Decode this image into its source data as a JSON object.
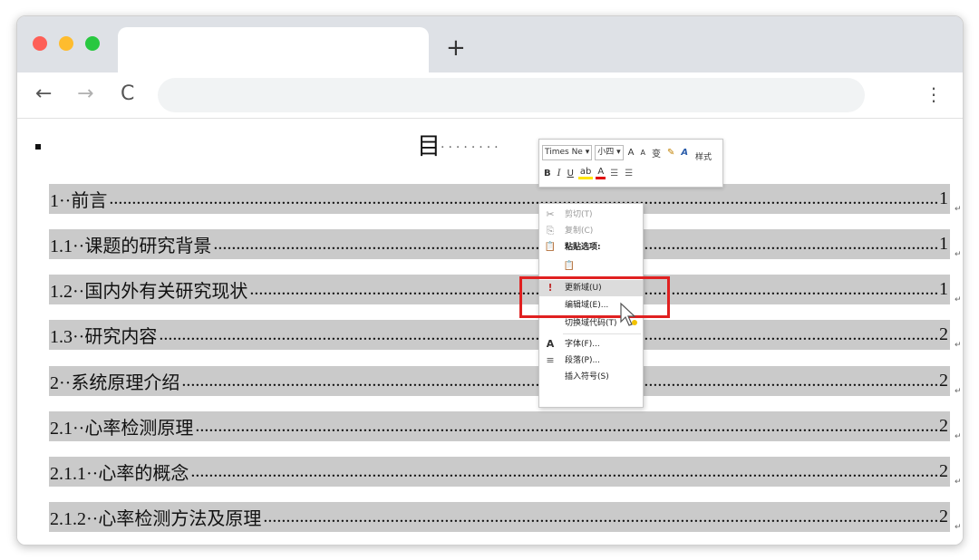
{
  "browser": {
    "new_tab_label": "+",
    "back_icon": "←",
    "forward_icon": "→",
    "reload_icon": "C",
    "menu_icon": "⋮",
    "address_value": ""
  },
  "document": {
    "heading": "目",
    "heading_dots": "········",
    "toc": [
      {
        "title": "1··前言",
        "page": "1"
      },
      {
        "title": "1.1··课题的研究背景",
        "page": "1"
      },
      {
        "title": "1.2··国内外有关研究现状",
        "page": "1"
      },
      {
        "title": "1.3··研究内容",
        "page": "2"
      },
      {
        "title": "2··系统原理介绍",
        "page": "2"
      },
      {
        "title": "2.1··心率检测原理",
        "page": "2"
      },
      {
        "title": "2.1.1··心率的概念",
        "page": "2"
      },
      {
        "title": "2.1.2··心率检测方法及原理",
        "page": "2"
      }
    ],
    "leader": "..................................................................................................................................................................................................................................................",
    "para_mark": "↵"
  },
  "mini_toolbar": {
    "font_name": "Times Ne ▾",
    "font_size": "小四 ▾",
    "grow_font": "A",
    "shrink_font": "A",
    "phonetic": "变",
    "format_painter": "✎",
    "styles_icon": "A",
    "bold": "B",
    "italic": "I",
    "underline": "U",
    "highlight": "ab",
    "font_color": "A",
    "bullets": "☰",
    "numbering": "☰",
    "styles_label": "样式"
  },
  "context_menu": {
    "items": [
      {
        "label": "剪切(T)",
        "icon": "✂",
        "state": "disabled"
      },
      {
        "label": "复制(C)",
        "icon": "⎘",
        "state": "disabled"
      },
      {
        "label": "粘贴选项:",
        "icon": "📋",
        "state": "bold"
      },
      {
        "label": "",
        "icon": "📋",
        "state": "normal"
      },
      {
        "label": "更新域(U)",
        "icon": "!",
        "state": "highlight"
      },
      {
        "label": "编辑域(E)...",
        "icon": "",
        "state": "normal"
      },
      {
        "label": "切换域代码(T)",
        "icon": "",
        "state": "normal"
      },
      {
        "label": "字体(F)...",
        "icon": "A",
        "state": "normal"
      },
      {
        "label": "段落(P)...",
        "icon": "≡",
        "state": "normal"
      },
      {
        "label": "插入符号(S)",
        "icon": "",
        "state": "normal"
      }
    ]
  },
  "colors": {
    "toc_highlight": "#cacaca",
    "callout_border": "#e02020",
    "titlebar": "#dee1e6"
  }
}
